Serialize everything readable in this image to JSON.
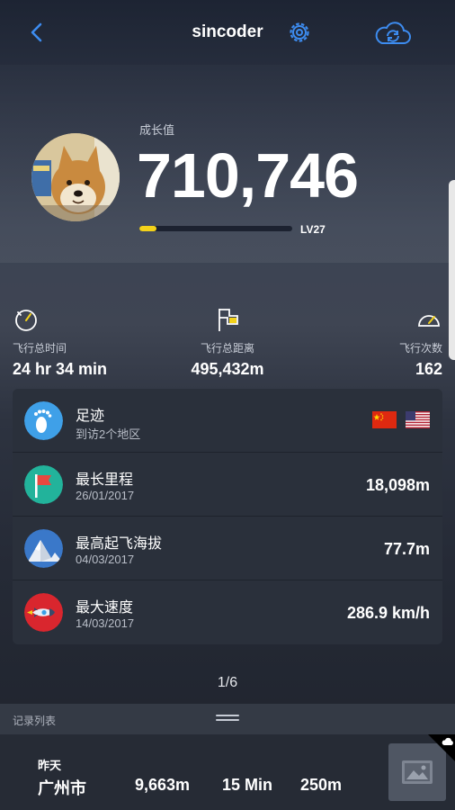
{
  "header": {
    "title": "sincoder",
    "back_icon": "back-arrow-icon",
    "settings_icon": "gear-icon",
    "sync_icon": "cloud-sync-icon",
    "accent": "#3d8cf0"
  },
  "profile": {
    "growth_label": "成长值",
    "growth_value": "710,746",
    "level": "LV27",
    "level_progress": 0.11
  },
  "stats": [
    {
      "label": "飞行总时间",
      "value": "24 hr 34 min",
      "icon": "clock-icon"
    },
    {
      "label": "飞行总距离",
      "value": "495,432m",
      "icon": "flag-outline-icon"
    },
    {
      "label": "飞行次数",
      "value": "162",
      "icon": "speedometer-icon"
    }
  ],
  "achievements": {
    "footprint": {
      "title": "足迹",
      "subtitle": "到访2个地区",
      "flags": [
        "china-flag-icon",
        "usa-flag-icon"
      ]
    },
    "longest": {
      "title": "最长里程",
      "date": "26/01/2017",
      "value": "18,098m"
    },
    "highest": {
      "title": "最高起飞海拔",
      "date": "04/03/2017",
      "value": "77.7m"
    },
    "fastest": {
      "title": "最大速度",
      "date": "14/03/2017",
      "value": "286.9 km/h"
    }
  },
  "pager": "1/6",
  "records": {
    "label": "记录列表",
    "items": [
      {
        "day": "昨天",
        "city": "广州市",
        "distance": "9,663m",
        "duration": "15 Min",
        "altitude": "250m"
      }
    ]
  }
}
